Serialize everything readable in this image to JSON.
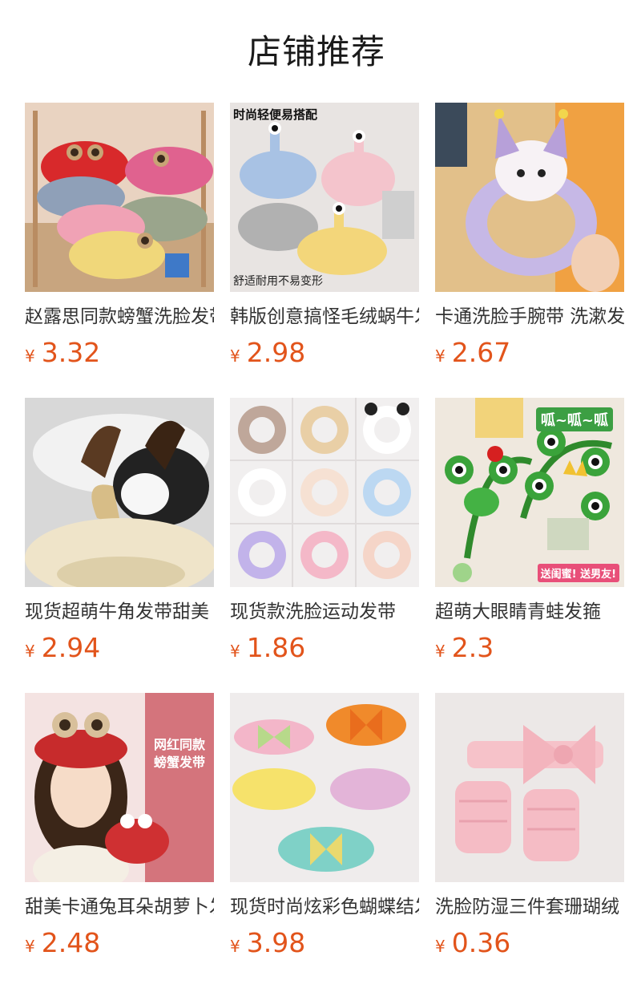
{
  "page": {
    "title": "店铺推荐"
  },
  "currency_symbol": "¥",
  "accent_color": "#e2541b",
  "products": [
    {
      "title": "赵露思同款螃蟹洗脸发带",
      "price": "3.32"
    },
    {
      "title": "韩版创意搞怪毛绒蜗牛发带",
      "price": "2.98",
      "image_caption_top": "时尚轻便易搭配",
      "image_caption_bottom": "舒适耐用不易变形"
    },
    {
      "title": "卡通洗脸手腕带 洗漱发带",
      "price": "2.67"
    },
    {
      "title": "现货超萌牛角发带甜美",
      "price": "2.94"
    },
    {
      "title": "现货款洗脸运动发带",
      "price": "1.86"
    },
    {
      "title": "超萌大眼睛青蛙发箍",
      "price": "2.3",
      "image_promo_top": "呱~呱~呱",
      "image_promo_bottom": "送闺蜜! 送男友!"
    },
    {
      "title": "甜美卡通兔耳朵胡萝卜发带",
      "price": "2.48",
      "image_promo_vertical": "网红同款 螃蟹发带"
    },
    {
      "title": "现货时尚炫彩色蝴蝶结发带",
      "price": "3.98"
    },
    {
      "title": "洗脸防湿三件套珊瑚绒",
      "price": "0.36"
    }
  ]
}
